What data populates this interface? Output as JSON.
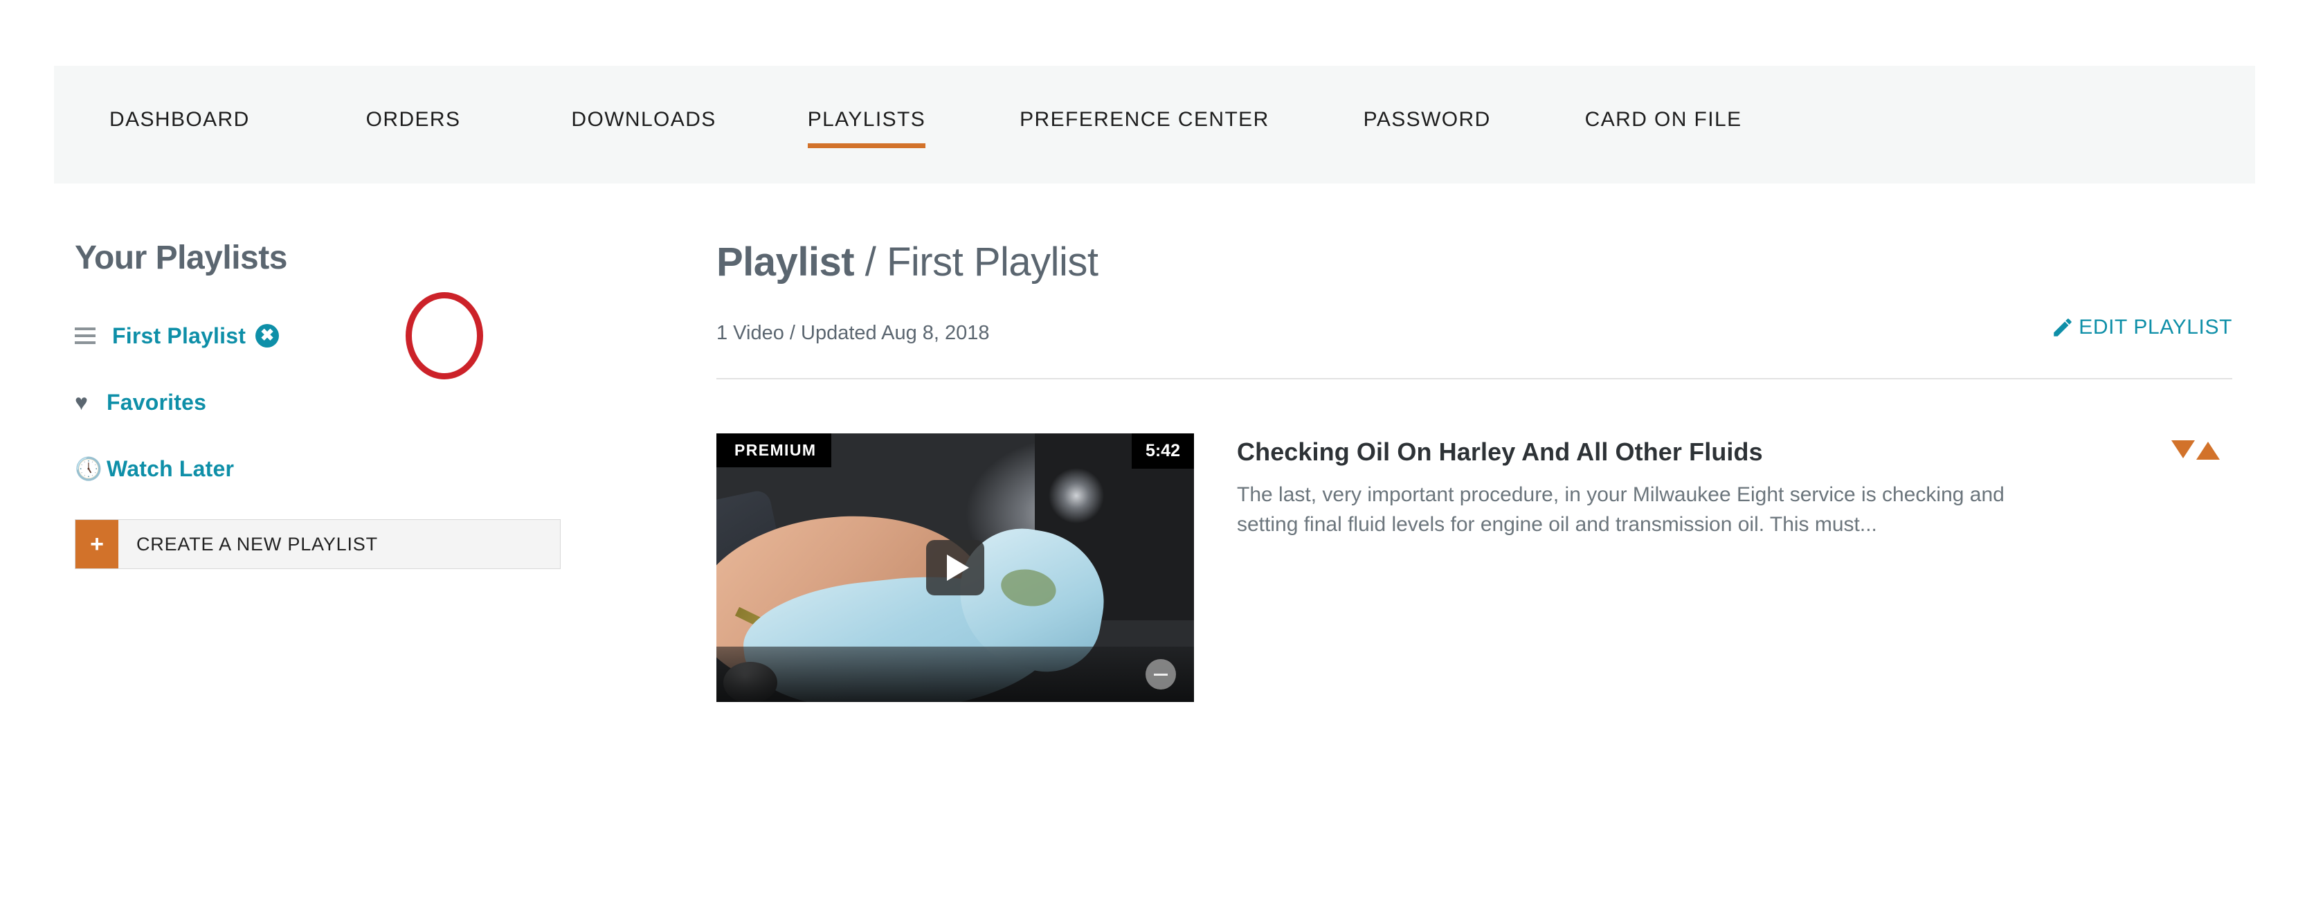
{
  "account_nav": {
    "tabs": [
      {
        "label": "DASHBOARD",
        "active": false
      },
      {
        "label": "ORDERS",
        "active": false
      },
      {
        "label": "DOWNLOADS",
        "active": false
      },
      {
        "label": "PLAYLISTS",
        "active": true
      },
      {
        "label": "PREFERENCE CENTER",
        "active": false
      },
      {
        "label": "PASSWORD",
        "active": false
      },
      {
        "label": "CARD ON FILE",
        "active": false
      }
    ],
    "active_tab": "PLAYLISTS",
    "active_underline_color": "#d2722a"
  },
  "sidebar": {
    "title": "Your Playlists",
    "items": [
      {
        "label": "First Playlist",
        "icon": "drag-handle-icon",
        "deletable": true,
        "delete_icon": "close-circle-icon"
      },
      {
        "label": "Favorites",
        "icon": "heart-icon",
        "deletable": false
      },
      {
        "label": "Watch Later",
        "icon": "clock-icon",
        "deletable": false
      }
    ],
    "create_button": {
      "label": "CREATE A NEW PLAYLIST",
      "plus_glyph": "+",
      "accent_color": "#d2722a"
    },
    "link_color": "#0e8fa8",
    "annotation": {
      "shape": "circle",
      "color": "#cc2229",
      "target": "delete-playlist-icon"
    }
  },
  "main": {
    "heading_prefix": "Playlist",
    "heading_separator": " / ",
    "heading_name": "First Playlist",
    "meta": "1 Video / Updated Aug 8, 2018",
    "edit_link": {
      "label": "EDIT PLAYLIST",
      "icon": "pencil-icon",
      "color": "#0e8fa8"
    },
    "videos": [
      {
        "badge": "PREMIUM",
        "duration": "5:42",
        "title": "Checking Oil On Harley And All Other Fluids",
        "description": "The last, very important procedure, in your Milwaukee Eight service is checking and setting final fluid levels for engine oil and transmission oil. This must...",
        "play_icon": "play-icon",
        "more_icon": "more-options-icon",
        "sort_down_icon": "arrow-down-icon",
        "sort_up_icon": "arrow-up-icon"
      }
    ]
  }
}
